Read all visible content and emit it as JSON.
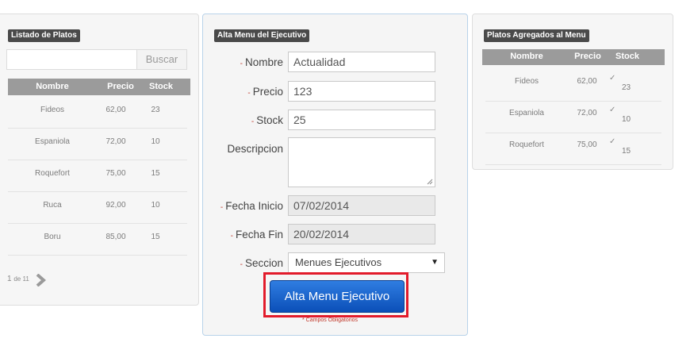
{
  "left": {
    "title": "Listado de Platos",
    "search": {
      "placeholder": "",
      "value": "",
      "button": "Buscar"
    },
    "headers": {
      "name": "Nombre",
      "price": "Precio",
      "stock": "Stock"
    },
    "rows": [
      {
        "name": "Fideos",
        "price": "62,00",
        "stock": "23"
      },
      {
        "name": "Espaniola",
        "price": "72,00",
        "stock": "10"
      },
      {
        "name": "Roquefort",
        "price": "75,00",
        "stock": "15"
      },
      {
        "name": "Ruca",
        "price": "92,00",
        "stock": "10"
      },
      {
        "name": "Boru",
        "price": "85,00",
        "stock": "15"
      }
    ],
    "pager": {
      "current": "1",
      "of": "de 11"
    }
  },
  "center": {
    "title": "Alta Menu del Ejecutivo",
    "required_mark": "-",
    "fields": {
      "nombre": {
        "label": "Nombre",
        "value": "Actualidad"
      },
      "precio": {
        "label": "Precio",
        "value": "123"
      },
      "stock": {
        "label": "Stock",
        "value": "25"
      },
      "descripcion": {
        "label": "Descripcion",
        "value": ""
      },
      "fecha_inicio": {
        "label": "Fecha Inicio",
        "value": "07/02/2014"
      },
      "fecha_fin": {
        "label": "Fecha Fin",
        "value": "20/02/2014"
      },
      "seccion": {
        "label": "Seccion",
        "value": "Menues Ejecutivos"
      }
    },
    "submit": "Alta Menu Ejecutivo",
    "required_note": "* Campos Obligatorios"
  },
  "right": {
    "title": "Platos Agregados al Menu",
    "headers": {
      "name": "Nombre",
      "price": "Precio",
      "stock": "Stock"
    },
    "rows": [
      {
        "name": "Fideos",
        "price": "62,00",
        "stock": "23",
        "checked": true
      },
      {
        "name": "Espaniola",
        "price": "72,00",
        "stock": "10",
        "checked": true
      },
      {
        "name": "Roquefort",
        "price": "75,00",
        "stock": "15",
        "checked": true
      }
    ]
  },
  "colors": {
    "primary": "#0b4fb8",
    "highlight": "#e21b2b",
    "header": "#9b9b9b",
    "title_bg": "#4a4a4a"
  }
}
